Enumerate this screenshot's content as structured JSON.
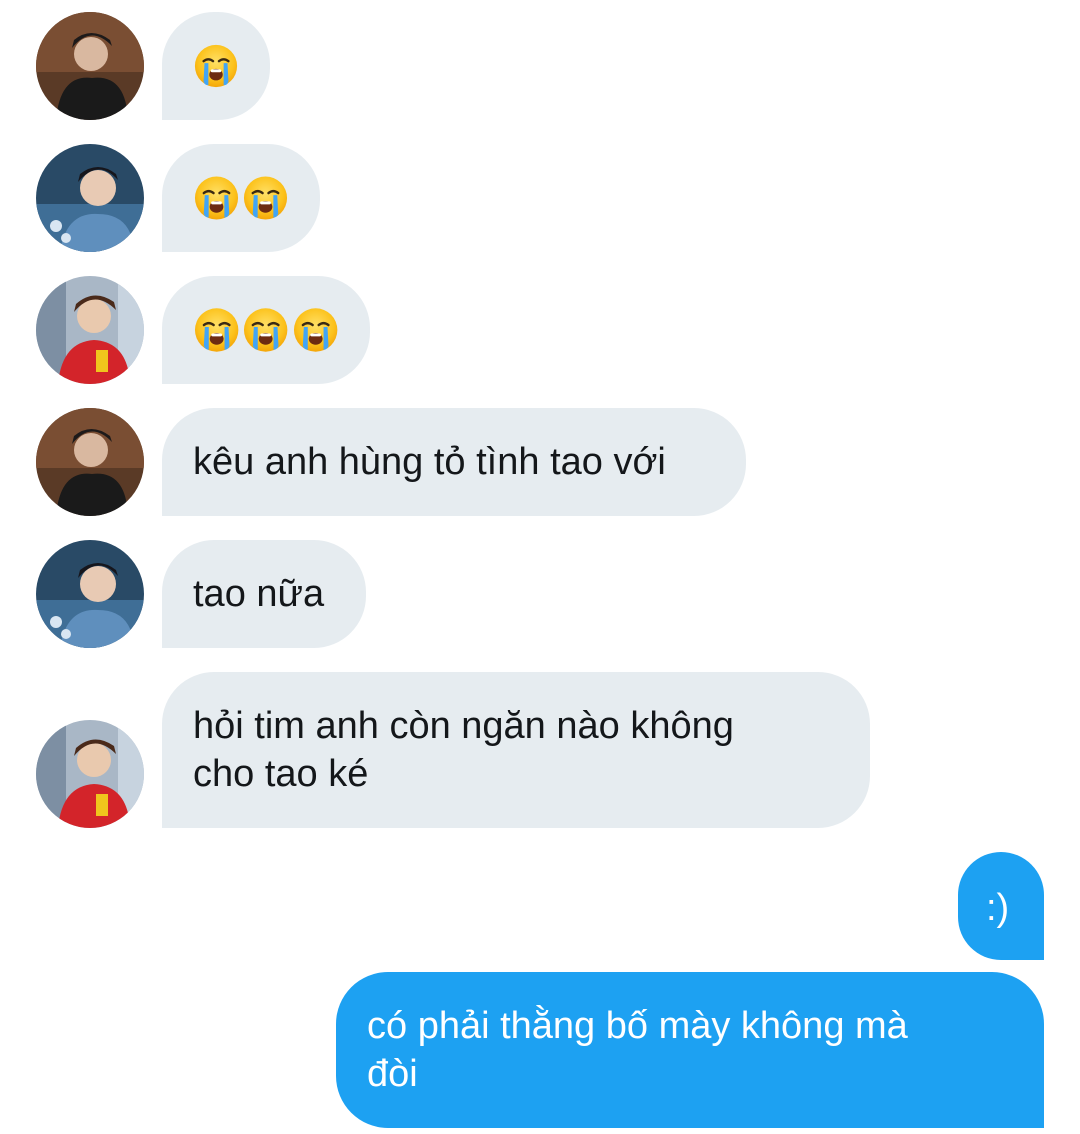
{
  "colors": {
    "incoming_bubble": "#e6ecf0",
    "outgoing_bubble": "#1da1f2",
    "incoming_text": "#14171a",
    "outgoing_text": "#ffffff"
  },
  "messages": [
    {
      "direction": "incoming",
      "avatar": "avatar-user-a",
      "emoji": [
        "loudly-crying-face"
      ],
      "text": ""
    },
    {
      "direction": "incoming",
      "avatar": "avatar-user-b",
      "emoji": [
        "loudly-crying-face",
        "loudly-crying-face"
      ],
      "text": ""
    },
    {
      "direction": "incoming",
      "avatar": "avatar-user-c",
      "emoji": [
        "loudly-crying-face",
        "loudly-crying-face",
        "loudly-crying-face"
      ],
      "text": ""
    },
    {
      "direction": "incoming",
      "avatar": "avatar-user-a",
      "emoji": [],
      "text": "kêu anh hùng tỏ tình tao với"
    },
    {
      "direction": "incoming",
      "avatar": "avatar-user-b",
      "emoji": [],
      "text": "tao nữa"
    },
    {
      "direction": "incoming",
      "avatar": "avatar-user-c",
      "emoji": [],
      "text": "hỏi tim anh còn ngăn nào không\ncho tao ké"
    },
    {
      "direction": "outgoing",
      "emoji": [],
      "text": ":)"
    },
    {
      "direction": "outgoing",
      "emoji": [],
      "text": "có phải thằng bố mày không mà\nđòi"
    }
  ]
}
